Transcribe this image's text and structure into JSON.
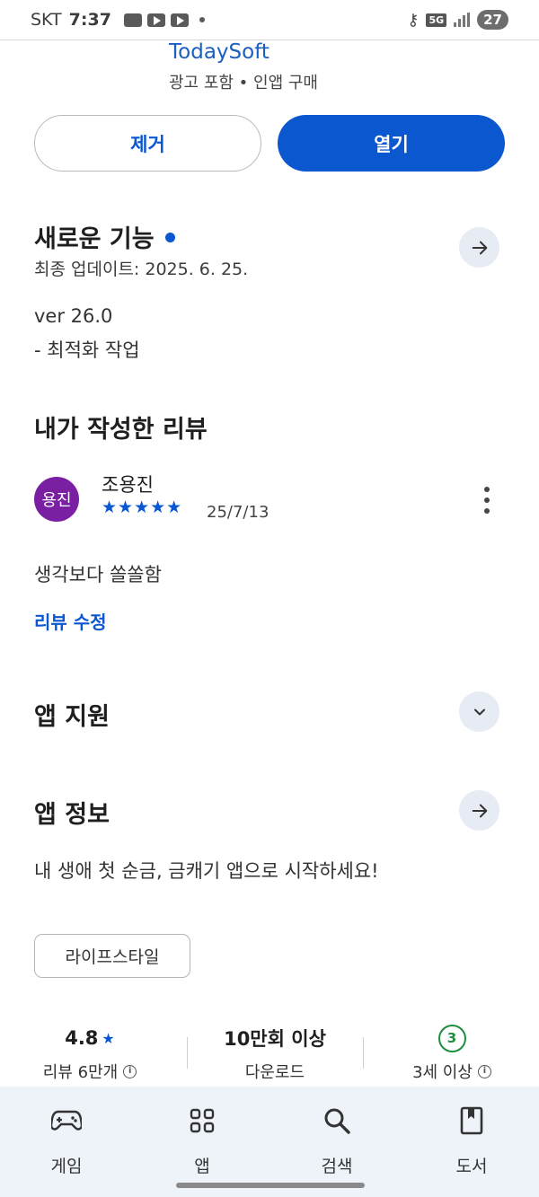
{
  "status_bar": {
    "carrier": "SKT",
    "time": "7:37",
    "network": "5G",
    "battery": "27"
  },
  "app": {
    "developer": "TodaySoft",
    "meta": "광고 포함 • 인앱 구매"
  },
  "actions": {
    "remove_label": "제거",
    "open_label": "열기"
  },
  "whats_new": {
    "title": "새로운 기능",
    "updated": "최종 업데이트: 2025. 6. 25.",
    "version": "ver 26.0",
    "notes": "- 최적화 작업"
  },
  "my_review": {
    "title": "내가 작성한 리뷰",
    "avatar_text": "용진",
    "reviewer": "조용진",
    "stars": "★★★★★",
    "rating": 5,
    "date": "25/7/13",
    "text": "생각보다 쏠쏠함",
    "edit_label": "리뷰 수정"
  },
  "app_support": {
    "title": "앱 지원"
  },
  "app_info": {
    "title": "앱 정보",
    "description": "내 생애 첫 순금, 금캐기 앱으로 시작하세요!",
    "category": "라이프스타일"
  },
  "stats": {
    "rating_value": "4.8",
    "rating_label": "리뷰 6만개",
    "downloads_value": "10만회 이상",
    "downloads_label": "다운로드",
    "age_badge": "3",
    "age_label": "3세 이상"
  },
  "bottom_nav": {
    "items": [
      {
        "label": "게임",
        "icon": "gamepad-icon"
      },
      {
        "label": "앱",
        "icon": "apps-grid-icon"
      },
      {
        "label": "검색",
        "icon": "search-icon"
      },
      {
        "label": "도서",
        "icon": "book-icon"
      }
    ]
  },
  "colors": {
    "accent": "#0b57d0",
    "avatar": "#7b1fa2",
    "age_badge": "#1e8e3e"
  }
}
